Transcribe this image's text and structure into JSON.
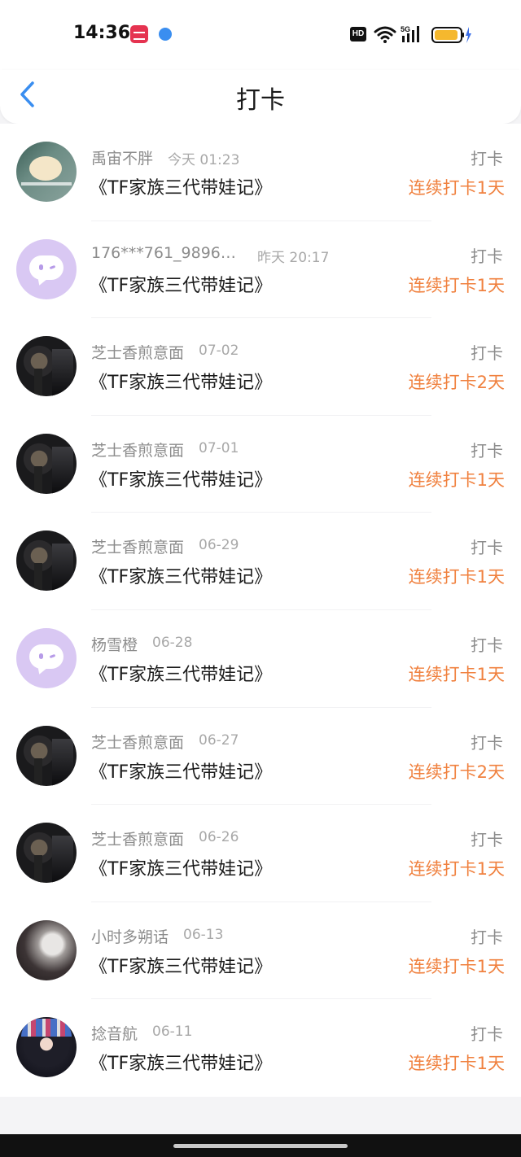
{
  "status_bar": {
    "time": "14:36",
    "network": "5G",
    "hd_label": "HD"
  },
  "header": {
    "title": "打卡",
    "back_icon": "chevron-left-icon"
  },
  "colors": {
    "accent": "#f0813f",
    "back_icon": "#3a8ef0",
    "chat_avatar_bg": "#d9c8f3"
  },
  "items": [
    {
      "username": "禹宙不胖",
      "date": "今天 01:23",
      "book": "《TF家族三代带娃记》",
      "action": "打卡",
      "streak": "连续打卡1天",
      "avatar": "photo-d"
    },
    {
      "username": "176***761_98969...",
      "date": "昨天 20:17",
      "book": "《TF家族三代带娃记》",
      "action": "打卡",
      "streak": "连续打卡1天",
      "avatar": "chat"
    },
    {
      "username": "芝士香煎意面",
      "date": "07-02",
      "book": "《TF家族三代带娃记》",
      "action": "打卡",
      "streak": "连续打卡2天",
      "avatar": "photo-a"
    },
    {
      "username": "芝士香煎意面",
      "date": "07-01",
      "book": "《TF家族三代带娃记》",
      "action": "打卡",
      "streak": "连续打卡1天",
      "avatar": "photo-a"
    },
    {
      "username": "芝士香煎意面",
      "date": "06-29",
      "book": "《TF家族三代带娃记》",
      "action": "打卡",
      "streak": "连续打卡1天",
      "avatar": "photo-a"
    },
    {
      "username": "杨雪橙",
      "date": "06-28",
      "book": "《TF家族三代带娃记》",
      "action": "打卡",
      "streak": "连续打卡1天",
      "avatar": "chat"
    },
    {
      "username": "芝士香煎意面",
      "date": "06-27",
      "book": "《TF家族三代带娃记》",
      "action": "打卡",
      "streak": "连续打卡2天",
      "avatar": "photo-a"
    },
    {
      "username": "芝士香煎意面",
      "date": "06-26",
      "book": "《TF家族三代带娃记》",
      "action": "打卡",
      "streak": "连续打卡1天",
      "avatar": "photo-a"
    },
    {
      "username": "小时多朔话",
      "date": "06-13",
      "book": "《TF家族三代带娃记》",
      "action": "打卡",
      "streak": "连续打卡1天",
      "avatar": "photo-b"
    },
    {
      "username": "捻音航",
      "date": "06-11",
      "book": "《TF家族三代带娃记》",
      "action": "打卡",
      "streak": "连续打卡1天",
      "avatar": "photo-c"
    }
  ]
}
